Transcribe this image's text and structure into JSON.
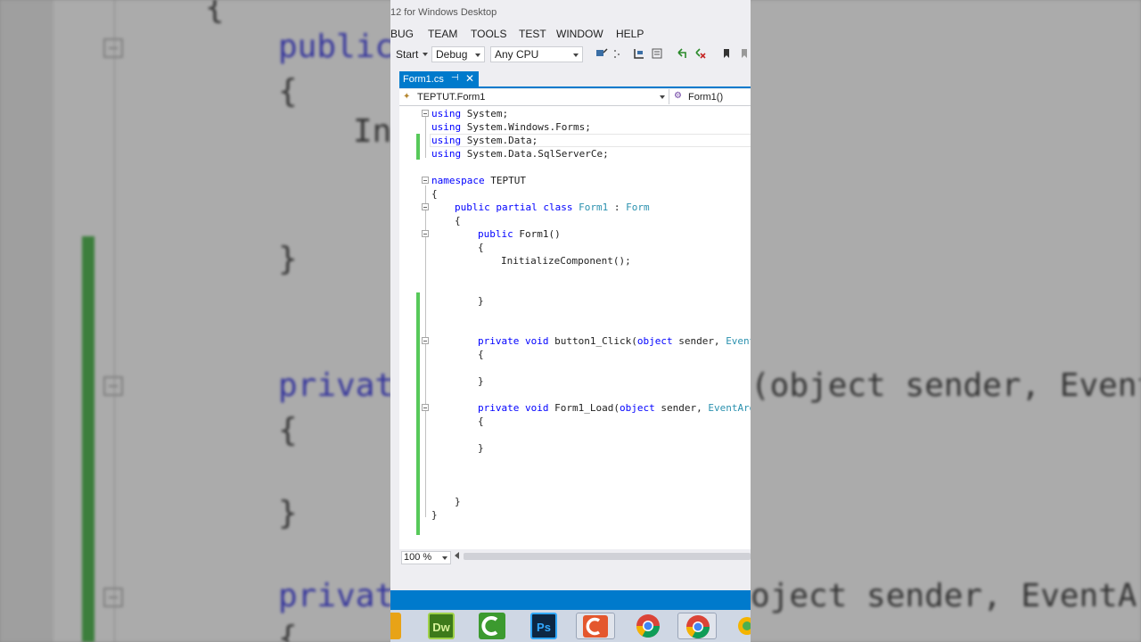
{
  "window": {
    "title": "12 for Windows Desktop"
  },
  "menu": {
    "items": [
      "BUG",
      "TEAM",
      "TOOLS",
      "TEST",
      "WINDOW",
      "HELP"
    ]
  },
  "toolbar": {
    "start_label": "Start",
    "config_value": "Debug",
    "platform_value": "Any CPU"
  },
  "tab": {
    "label": "Form1.cs",
    "pin": "⊣",
    "close": "✕"
  },
  "navbar": {
    "class_scope": "TEPTUT.Form1",
    "member_scope": "Form1()"
  },
  "code": {
    "lines": [
      {
        "kw": "using",
        "rest": " System;"
      },
      {
        "kw": "using",
        "rest": " System.Windows.Forms;"
      },
      {
        "kw": "using",
        "rest": " System.Data;"
      },
      {
        "kw": "using",
        "rest": " System.Data.SqlServerCe;"
      },
      {
        "kw": "namespace",
        "rest": " TEPTUT"
      },
      {
        "text": "{"
      },
      {
        "kw": "public partial class",
        "plain": " ",
        "ty": "Form1",
        "plain2": " : ",
        "ty2": "Form"
      },
      {
        "text": "{"
      },
      {
        "kw": "public",
        "rest": " Form1()"
      },
      {
        "text": "{"
      },
      {
        "text": "InitializeComponent();"
      },
      {
        "text": "}"
      },
      {
        "kw": "private void",
        "rest": " button1_Click(",
        "kw2": "object",
        "rest2": " sender, ",
        "ty": "EventArgs e)"
      },
      {
        "text": "{"
      },
      {
        "text": "}"
      },
      {
        "kw": "private void",
        "rest": " Form1_Load(",
        "kw2": "object",
        "rest2": " sender, ",
        "ty": "EventArgs e)"
      },
      {
        "text": "{"
      },
      {
        "text": "}"
      },
      {
        "text": "}"
      },
      {
        "text": "}"
      }
    ]
  },
  "status": {
    "zoom": "100 %"
  },
  "taskbar": {
    "apps": [
      "dreamweaver",
      "camtasia",
      "photoshop",
      "camtasia-recorder",
      "chrome",
      "chrome-active",
      "misc"
    ],
    "dw_label": "Dw",
    "ps_label": "Ps"
  },
  "background": {
    "line1": "public",
    "line2": "{",
    "line3": "In",
    "line4": "}",
    "line5": "privat",
    "line5_tail": "(object sender, Event",
    "line6": "{",
    "line7": "}",
    "line8": "privat",
    "line8_tail": "oject sender, EventArg",
    "line9": "{"
  },
  "colors": {
    "accent": "#007acc",
    "keyword": "#0000ff",
    "type": "#2b91af",
    "change_marker": "#57c95a"
  }
}
